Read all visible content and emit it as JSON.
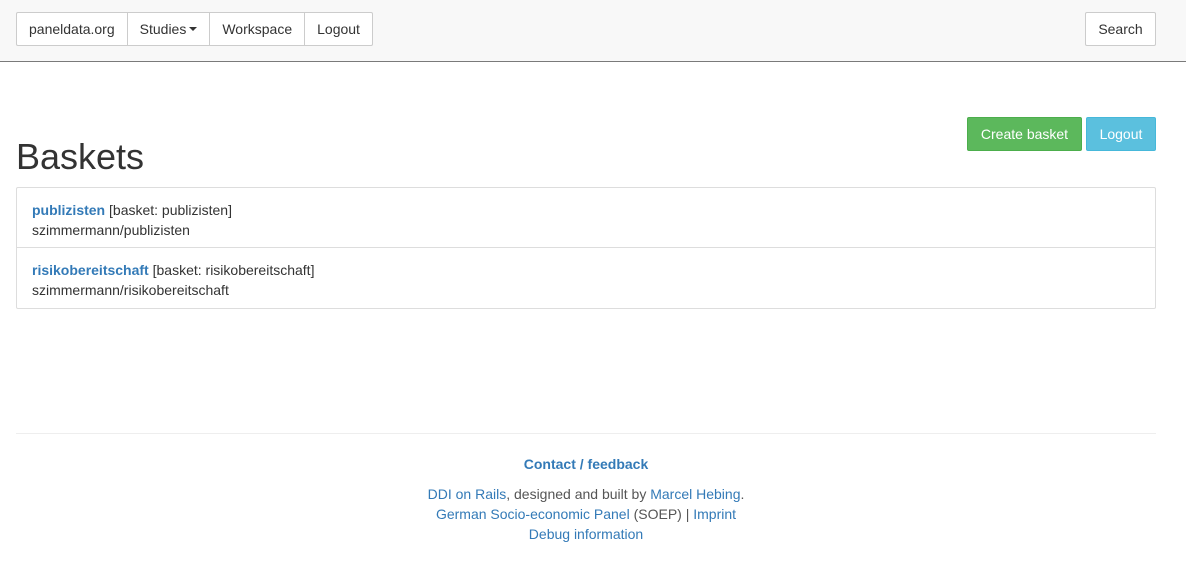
{
  "navbar": {
    "brand": "paneldata.org",
    "studies": "Studies",
    "workspace": "Workspace",
    "logout": "Logout",
    "search": "Search"
  },
  "page": {
    "title": "Baskets",
    "create_button": "Create basket",
    "logout_button": "Logout"
  },
  "baskets": [
    {
      "name": "publizisten",
      "tag": "[basket: publizisten]",
      "path": "szimmermann/publizisten"
    },
    {
      "name": "risikobereitschaft",
      "tag": "[basket: risikobereitschaft]",
      "path": "szimmermann/risikobereitschaft"
    }
  ],
  "footer": {
    "contact": "Contact / feedback",
    "ddi_link": "DDI on Rails",
    "built_text": ", designed and built by ",
    "author_link": "Marcel Hebing",
    "period": ".",
    "soep_link": "German Socio-economic Panel",
    "soep_text": " (SOEP) | ",
    "imprint_link": "Imprint",
    "debug_link": "Debug information"
  },
  "colors": {
    "link": "#337ab7",
    "success": "#5cb85c",
    "info": "#5bc0de"
  }
}
